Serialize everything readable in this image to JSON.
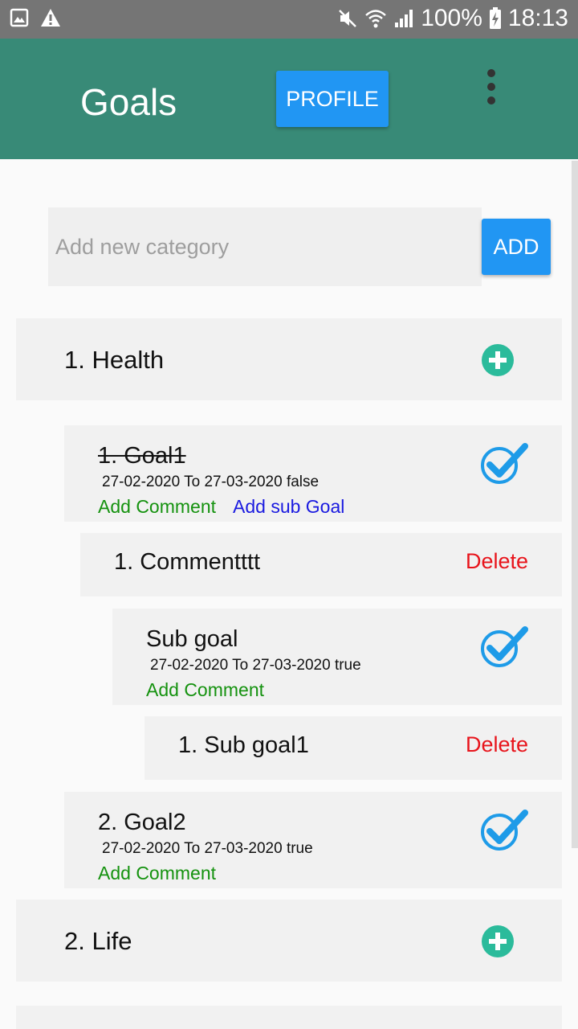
{
  "status_bar": {
    "left_icons": [
      "image-icon",
      "warning-icon"
    ],
    "right_icons": [
      "mute-icon",
      "wifi-icon",
      "signal-icon",
      "battery-icon"
    ],
    "battery": "100%",
    "time": "18:13"
  },
  "app_bar": {
    "title": "Goals",
    "profile_label": "PROFILE",
    "menu_icon": "overflow-menu-icon",
    "color": "#388a77"
  },
  "new_category": {
    "placeholder": "Add new category",
    "add_label": "ADD"
  },
  "categories": [
    {
      "label": "1. Health",
      "goals": [
        {
          "title": "1. Goal1",
          "dates": "27-02-2020 To 27-03-2020 false",
          "add_comment": "Add Comment",
          "add_sub_goal": "Add sub Goal",
          "comments": [
            {
              "text": "1. Commentttt",
              "delete": "Delete"
            }
          ],
          "sub_goals": [
            {
              "title": "Sub goal",
              "dates": "27-02-2020 To 27-03-2020 true",
              "add_comment": "Add Comment",
              "comments": [
                {
                  "text": "1. Sub goal1",
                  "delete": "Delete"
                }
              ]
            }
          ]
        },
        {
          "title": "2. Goal2",
          "dates": "27-02-2020 To 27-03-2020 true",
          "add_comment": "Add Comment"
        }
      ]
    },
    {
      "label": "2. Life"
    }
  ],
  "colors": {
    "accent_button": "#2196f3",
    "add_comment": "#15920f",
    "add_sub_goal": "#1a1ae0",
    "delete": "#e8141b",
    "plus_icon": "#2bbb9b",
    "check_icon": "#1e9be8"
  }
}
